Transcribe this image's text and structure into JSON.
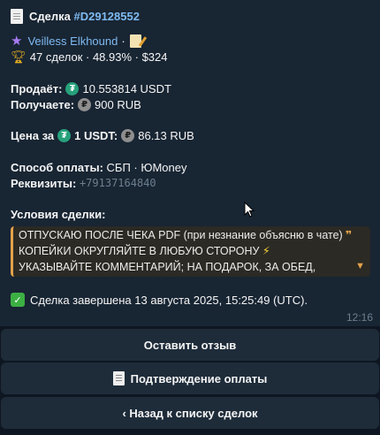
{
  "message": {
    "title_prefix": "Сделка",
    "deal_id": "#D29128552",
    "user": {
      "name": "Veilless Elkhound",
      "separator": "·",
      "stats": "47 сделок · 48.93% · $324"
    },
    "seller_label": "Продаёт:",
    "seller_amount": "10.553814 USDT",
    "buyer_label": "Получаете:",
    "buyer_amount": "900 RUB",
    "price_label": "Цена за",
    "price_unit": "1 USDT:",
    "price_value": "86.13 RUB",
    "payment_label": "Способ оплаты:",
    "payment_value": "СБП · ЮMoney",
    "requisites_label": "Реквизиты:",
    "requisites_value": "+79137164840",
    "terms_label": "Условия сделки:",
    "terms_line1": "ОТПУСКАЮ ПОСЛЕ ЧЕКА PDF (при незнание объясню в чате)",
    "terms_line2": "КОПЕЙКИ ОКРУГЛЯЙТЕ В ЛЮБУЮ СТОРОНУ",
    "terms_line3": "УКАЗЫВАЙТЕ КОММЕНТАРИЙ; НА ПОДАРОК, ЗА ОБЕД,",
    "status": "Сделка завершена 13 августа 2025, 15:25:49 (UTC).",
    "time": "12:16"
  },
  "buttons": {
    "review": "Оставить отзыв",
    "payment_confirm": "Подтверждение оплаты",
    "back": "‹ Назад к списку сделок"
  },
  "icons": {
    "title": "document-icon",
    "user": "star-icon",
    "stats": "trophy-icon",
    "edit": "memo-icon",
    "usdt": "tether-icon",
    "rub": "ruble-icon",
    "status": "check-icon",
    "expand": "chevron-down-icon",
    "pointer": "mouse-cursor-icon"
  },
  "colors": {
    "background": "#0e1621",
    "bubble": "#182533",
    "link": "#7fbaf1",
    "quote_accent": "#e4a24a",
    "button": "#1e2c3a",
    "tether": "#26a17b",
    "check": "#3cb043"
  }
}
